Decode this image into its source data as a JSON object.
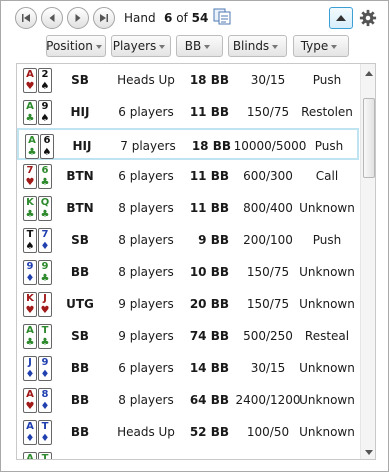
{
  "nav": {
    "hand_label": "Hand",
    "current": "6",
    "of_text": "of",
    "total": "54"
  },
  "filters": [
    "Position",
    "Players",
    "BB",
    "Blinds",
    "Type"
  ],
  "colors": {
    "hearts": "#a01818",
    "spades": "#111111",
    "clubs": "#2d8a2d",
    "diamonds": "#2040b0",
    "accent": "#3c9fd6"
  },
  "hands": [
    {
      "c1": {
        "rank": "A",
        "suit": "♥",
        "color": "#a01818"
      },
      "c2": {
        "rank": "2",
        "suit": "♠",
        "color": "#111111"
      },
      "position": "SB",
      "players": "Heads Up",
      "bb": "18 BB",
      "blinds": "30/15",
      "type": "Push"
    },
    {
      "c1": {
        "rank": "A",
        "suit": "♣",
        "color": "#2d8a2d"
      },
      "c2": {
        "rank": "9",
        "suit": "♠",
        "color": "#111111"
      },
      "position": "HIJ",
      "players": "6 players",
      "bb": "11 BB",
      "blinds": "150/75",
      "type": "Restolen"
    },
    {
      "c1": {
        "rank": "A",
        "suit": "♣",
        "color": "#2d8a2d"
      },
      "c2": {
        "rank": "6",
        "suit": "♠",
        "color": "#111111"
      },
      "position": "HIJ",
      "players": "7 players",
      "bb": "18 BB",
      "blinds": "10000/5000",
      "type": "Push",
      "selected": true
    },
    {
      "c1": {
        "rank": "7",
        "suit": "♥",
        "color": "#a01818"
      },
      "c2": {
        "rank": "6",
        "suit": "♣",
        "color": "#2d8a2d"
      },
      "position": "BTN",
      "players": "6 players",
      "bb": "11 BB",
      "blinds": "600/300",
      "type": "Call"
    },
    {
      "c1": {
        "rank": "K",
        "suit": "♣",
        "color": "#2d8a2d"
      },
      "c2": {
        "rank": "Q",
        "suit": "♣",
        "color": "#2d8a2d"
      },
      "position": "BTN",
      "players": "8 players",
      "bb": "11 BB",
      "blinds": "800/400",
      "type": "Unknown"
    },
    {
      "c1": {
        "rank": "T",
        "suit": "♠",
        "color": "#111111"
      },
      "c2": {
        "rank": "7",
        "suit": "♦",
        "color": "#2040b0"
      },
      "position": "SB",
      "players": "8 players",
      "bb": "9 BB",
      "blinds": "200/100",
      "type": "Push"
    },
    {
      "c1": {
        "rank": "9",
        "suit": "♦",
        "color": "#2040b0"
      },
      "c2": {
        "rank": "9",
        "suit": "♣",
        "color": "#2d8a2d"
      },
      "position": "BB",
      "players": "8 players",
      "bb": "10 BB",
      "blinds": "150/75",
      "type": "Unknown"
    },
    {
      "c1": {
        "rank": "K",
        "suit": "♥",
        "color": "#a01818"
      },
      "c2": {
        "rank": "J",
        "suit": "♥",
        "color": "#a01818"
      },
      "position": "UTG",
      "players": "9 players",
      "bb": "20 BB",
      "blinds": "150/75",
      "type": "Unknown"
    },
    {
      "c1": {
        "rank": "A",
        "suit": "♣",
        "color": "#2d8a2d"
      },
      "c2": {
        "rank": "T",
        "suit": "♣",
        "color": "#2d8a2d"
      },
      "position": "SB",
      "players": "9 players",
      "bb": "74 BB",
      "blinds": "500/250",
      "type": "Resteal"
    },
    {
      "c1": {
        "rank": "J",
        "suit": "♦",
        "color": "#2040b0"
      },
      "c2": {
        "rank": "9",
        "suit": "♦",
        "color": "#2040b0"
      },
      "position": "BB",
      "players": "6 players",
      "bb": "14 BB",
      "blinds": "30/15",
      "type": "Unknown"
    },
    {
      "c1": {
        "rank": "A",
        "suit": "♥",
        "color": "#a01818"
      },
      "c2": {
        "rank": "8",
        "suit": "♦",
        "color": "#2040b0"
      },
      "position": "BB",
      "players": "8 players",
      "bb": "64 BB",
      "blinds": "2400/1200",
      "type": "Unknown"
    },
    {
      "c1": {
        "rank": "A",
        "suit": "♦",
        "color": "#2040b0"
      },
      "c2": {
        "rank": "T",
        "suit": "♦",
        "color": "#2040b0"
      },
      "position": "BB",
      "players": "Heads Up",
      "bb": "52 BB",
      "blinds": "100/50",
      "type": "Unknown"
    },
    {
      "c1": {
        "rank": "A",
        "suit": "♣",
        "color": "#2d8a2d"
      },
      "c2": {
        "rank": "T",
        "suit": "♣",
        "color": "#2d8a2d"
      },
      "position": "",
      "players": "",
      "bb": "",
      "blinds": "",
      "type": ""
    }
  ]
}
